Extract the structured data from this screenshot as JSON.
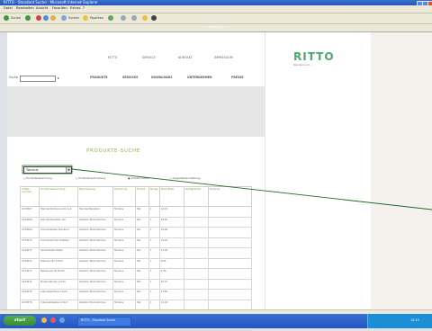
{
  "window": {
    "title": "RITTO - Standard Suche - Microsoft Internet Explorer"
  },
  "menu": [
    "Datei",
    "Bearbeiten",
    "Ansicht",
    "Favoriten",
    "Extras",
    "?"
  ],
  "toolbar": {
    "back": "Zurück",
    "search": "Suchen",
    "favorites": "Favoriten"
  },
  "address": {
    "label": "Adresse",
    "url": "http://www.ritto.de/de/produkte/produktsuche.php",
    "go": "Wechseln zu"
  },
  "site": {
    "top_links": [
      "RITTO",
      "SERVICE",
      "KONTAKT",
      "IMPRESSUM"
    ],
    "search_label": "Suche",
    "main_nav": [
      "PRODUKTE",
      "SERVICES",
      "DOWNLOADS",
      "UNTERNEHMEN",
      "PRESSE"
    ],
    "logo": "RITTO",
    "logo_tagline": "Standard und ...",
    "section_title": "PRODUKTE-SUCHE",
    "select_value": "Twinbus",
    "radio_options": [
      "Produktbezeichnung",
      "Produktbeschreibung",
      "Artikelnummer",
      "Ausgabebeschreibung"
    ],
    "table": {
      "headers": [
        "Artikel-nummer",
        "Produkt-bezeichnung",
        "Beschreibung",
        "Zuordnung",
        "Einheit",
        "Menge",
        "Preis (EUR)",
        "Verfügbarkeit",
        "Hinweise"
      ],
      "rows": [
        [
          "1234567",
          "Standardkomponente 4+4",
          "Standardbaustein",
          "Twinbus",
          "Stk.",
          "1",
          "12,45"
        ],
        [
          "1234568",
          "Standardbaustein Ver.",
          "Zubehör Modulrahmen",
          "Twinbus",
          "Stk.",
          "1",
          "18,50"
        ],
        [
          "1234569",
          "Anschlußkabel Standard",
          "Zubehör Modulrahmen",
          "Twinbus",
          "Stk.",
          "1",
          "24,90"
        ],
        [
          "1234570",
          "Anschlußmodul Verteiler",
          "Zubehör Modulrahmen",
          "Twinbus",
          "Stk.",
          "1",
          "15,20"
        ],
        [
          "1234571",
          "Sprechstelle Tasten",
          "Zubehör Modulrahmen",
          "Twinbus",
          "Stk.",
          "1",
          "31,00"
        ],
        [
          "1234572",
          "Tastermodul 2-fach",
          "Zubehör Modulrahmen",
          "Twinbus",
          "Stk.",
          "1",
          "9,85"
        ],
        [
          "1234573",
          "Namensschild Modul",
          "Zubehör Modulrahmen",
          "Twinbus",
          "Stk.",
          "1",
          "4,30"
        ],
        [
          "1234574",
          "Einbaurahmen 3-fach",
          "Zubehör Modulrahmen",
          "Twinbus",
          "Stk.",
          "1",
          "22,75"
        ],
        [
          "1234575",
          "Aufputzgehäuse 3-fach",
          "Zubehör Modulrahmen",
          "Twinbus",
          "Stk.",
          "1",
          "27,60"
        ],
        [
          "1234576",
          "Unterputzkasten 2-fach",
          "Zubehör Modulrahmen",
          "Twinbus",
          "Stk.",
          "1",
          "11,40"
        ],
        [
          "1234577",
          "Netzteil Twinbus",
          "Zubehör Modulrahmen",
          "Twinbus",
          "Stk.",
          "1",
          "45,80"
        ],
        [
          "1234578",
          "Türstation Audio",
          "Zubehör Modulrahmen",
          "Twinbus",
          "Stk.",
          "1",
          "59,00"
        ]
      ]
    }
  },
  "taskbar": {
    "start": "start",
    "task": "RITTO - Standard Suche",
    "clock": "10:15"
  }
}
